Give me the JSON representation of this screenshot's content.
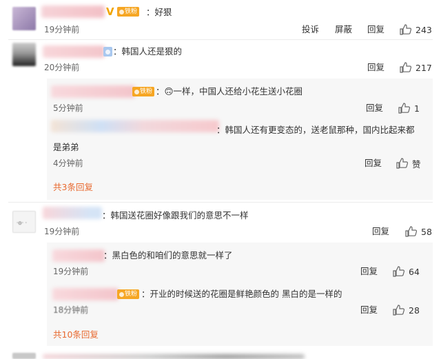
{
  "badge_label": "铁粉",
  "actions": {
    "report": "投诉",
    "block": "屏蔽",
    "reply": "回复"
  },
  "comments": [
    {
      "text": "：好狠",
      "time": "19分钟前",
      "likes": "243"
    },
    {
      "text": "：韩国人还是狠的",
      "time": "20分钟前",
      "likes": "217",
      "replies": [
        {
          "text": "：🙃一样，中国人还给小花生送小花圈",
          "time": "5分钟前",
          "likes": "1"
        },
        {
          "text_line1": "：韩国人还有更变态的，送老鼠那种，国内比起来都",
          "text_line2": "是弟弟",
          "time": "4分钟前",
          "likes": "赞"
        }
      ],
      "more": "共3条回复"
    },
    {
      "text": "：韩国送花圈好像跟我们的意思不一样",
      "time": "19分钟前",
      "likes": "58",
      "replies": [
        {
          "text": "：黑白色的和咱们的意思就一样了",
          "time": "19分钟前",
          "likes": "64"
        },
        {
          "text": "：开业的时候送的花圈是鲜艳颜色的 黑白的是一样的",
          "time": "18分钟前",
          "likes": "28"
        }
      ],
      "more": "共10条回复"
    }
  ],
  "colors": {
    "accent": "#e86a30",
    "badge": "#f6a623",
    "sub_bg": "#f7f7f7"
  }
}
